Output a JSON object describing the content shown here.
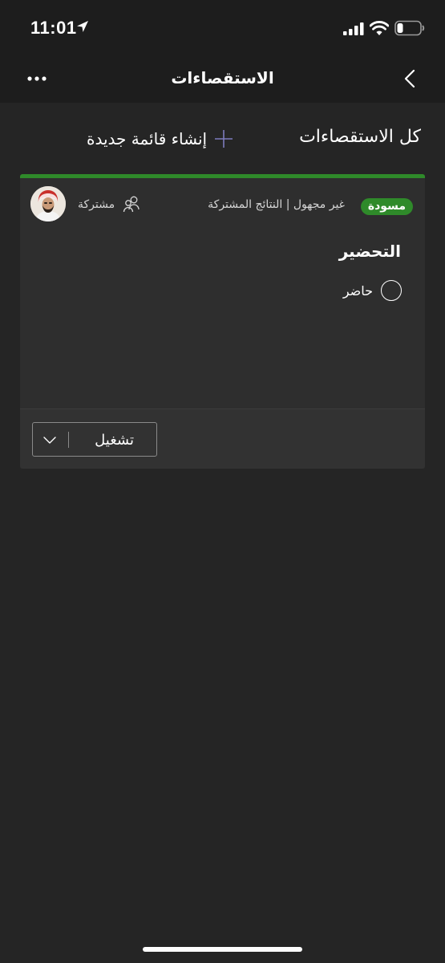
{
  "status_bar": {
    "time": "11:01"
  },
  "nav": {
    "title": "الاستقصاءات",
    "more_icon": "more-horizontal-icon",
    "back_icon": "chevron-back-icon"
  },
  "section": {
    "title": "كل الاستقصاءات",
    "create_label": "إنشاء قائمة جديدة",
    "create_icon": "plus-icon"
  },
  "card": {
    "status_badge": "مسودة",
    "meta": "غير مجهول | النتائج المشتركة",
    "shared_label": "مشتركة",
    "question": "التحضير",
    "options": [
      {
        "label": "حاضر"
      }
    ],
    "run_label": "تشغيل"
  },
  "colors": {
    "accent_green": "#2f8a2a",
    "background": "#252525",
    "card": "#2e2e2e",
    "header": "#1d1d1d",
    "plus": "#7d7bbd"
  }
}
